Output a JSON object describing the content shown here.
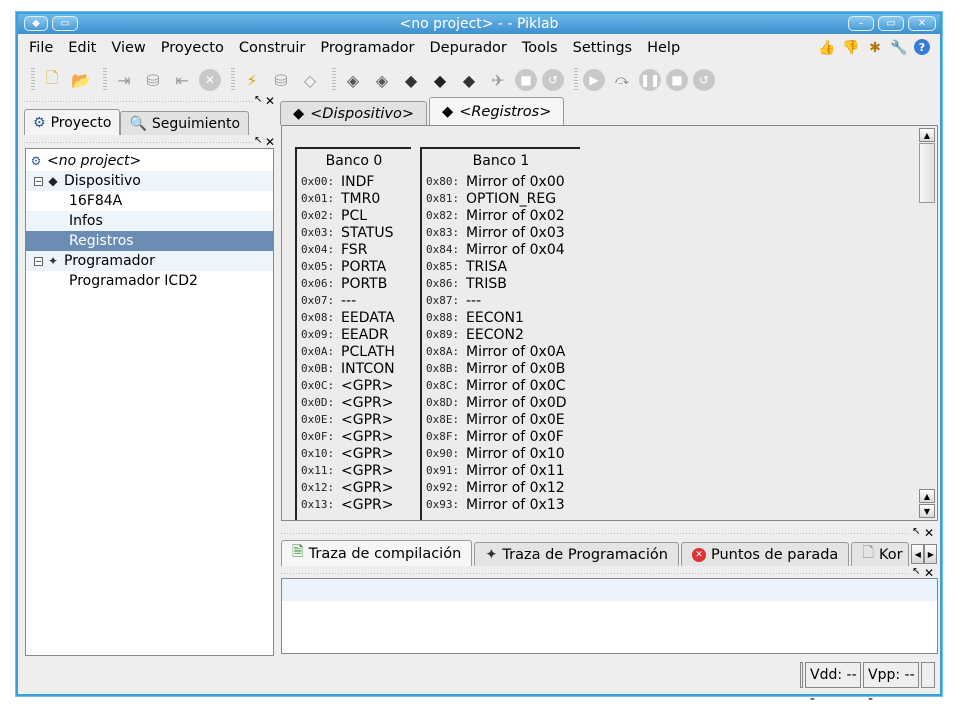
{
  "window": {
    "title": "<no project> -  - Piklab"
  },
  "menubar": {
    "items": [
      {
        "label": "File",
        "name": "menu-file"
      },
      {
        "label": "Edit",
        "name": "menu-edit"
      },
      {
        "label": "View",
        "name": "menu-view"
      },
      {
        "label": "Proyecto",
        "name": "menu-proyecto"
      },
      {
        "label": "Construir",
        "name": "menu-construir"
      },
      {
        "label": "Programador",
        "name": "menu-programador"
      },
      {
        "label": "Depurador",
        "name": "menu-depurador"
      },
      {
        "label": "Tools",
        "name": "menu-tools"
      },
      {
        "label": "Settings",
        "name": "menu-settings"
      },
      {
        "label": "Help",
        "name": "menu-help"
      }
    ],
    "right_icons": [
      "thumbs-up-icon",
      "thumbs-down-icon",
      "bug-icon",
      "wrench-icon",
      "help-icon"
    ]
  },
  "left_panel": {
    "tabs": [
      "Proyecto",
      "Seguimiento"
    ],
    "tree": {
      "root": "<no project>",
      "dispositivo": "Dispositivo",
      "device": "16F84A",
      "infos": "Infos",
      "registros": "Registros",
      "programador": "Programador",
      "programador_icd2": "Programador ICD2"
    }
  },
  "editor": {
    "tabs": [
      "<Dispositivo>",
      "<Registros>"
    ],
    "bank0": {
      "title": "Banco 0",
      "rows": [
        {
          "addr": "0x00:",
          "name": "INDF"
        },
        {
          "addr": "0x01:",
          "name": "TMR0"
        },
        {
          "addr": "0x02:",
          "name": "PCL"
        },
        {
          "addr": "0x03:",
          "name": "STATUS"
        },
        {
          "addr": "0x04:",
          "name": "FSR"
        },
        {
          "addr": "0x05:",
          "name": "PORTA"
        },
        {
          "addr": "0x06:",
          "name": "PORTB"
        },
        {
          "addr": "0x07:",
          "name": "---"
        },
        {
          "addr": "0x08:",
          "name": "EEDATA"
        },
        {
          "addr": "0x09:",
          "name": "EEADR"
        },
        {
          "addr": "0x0A:",
          "name": "PCLATH"
        },
        {
          "addr": "0x0B:",
          "name": "INTCON"
        },
        {
          "addr": "0x0C:",
          "name": "<GPR>"
        },
        {
          "addr": "0x0D:",
          "name": "<GPR>"
        },
        {
          "addr": "0x0E:",
          "name": "<GPR>"
        },
        {
          "addr": "0x0F:",
          "name": "<GPR>"
        },
        {
          "addr": "0x10:",
          "name": "<GPR>"
        },
        {
          "addr": "0x11:",
          "name": "<GPR>"
        },
        {
          "addr": "0x12:",
          "name": "<GPR>"
        },
        {
          "addr": "0x13:",
          "name": "<GPR>"
        }
      ]
    },
    "bank1": {
      "title": "Banco 1",
      "rows": [
        {
          "addr": "0x80:",
          "name": "Mirror of 0x00"
        },
        {
          "addr": "0x81:",
          "name": "OPTION_REG"
        },
        {
          "addr": "0x82:",
          "name": "Mirror of 0x02"
        },
        {
          "addr": "0x83:",
          "name": "Mirror of 0x03"
        },
        {
          "addr": "0x84:",
          "name": "Mirror of 0x04"
        },
        {
          "addr": "0x85:",
          "name": "TRISA"
        },
        {
          "addr": "0x86:",
          "name": "TRISB"
        },
        {
          "addr": "0x87:",
          "name": "---"
        },
        {
          "addr": "0x88:",
          "name": "EECON1"
        },
        {
          "addr": "0x89:",
          "name": "EECON2"
        },
        {
          "addr": "0x8A:",
          "name": "Mirror of 0x0A"
        },
        {
          "addr": "0x8B:",
          "name": "Mirror of 0x0B"
        },
        {
          "addr": "0x8C:",
          "name": "Mirror of 0x0C"
        },
        {
          "addr": "0x8D:",
          "name": "Mirror of 0x0D"
        },
        {
          "addr": "0x8E:",
          "name": "Mirror of 0x0E"
        },
        {
          "addr": "0x8F:",
          "name": "Mirror of 0x0F"
        },
        {
          "addr": "0x90:",
          "name": "Mirror of 0x10"
        },
        {
          "addr": "0x91:",
          "name": "Mirror of 0x11"
        },
        {
          "addr": "0x92:",
          "name": "Mirror of 0x12"
        },
        {
          "addr": "0x93:",
          "name": "Mirror of 0x13"
        }
      ]
    }
  },
  "bottom_panel": {
    "tabs": [
      "Traza de compilación",
      "Traza de Programación",
      "Puntos de parada",
      "Kor"
    ]
  },
  "statusbar": {
    "vdd": "Vdd: ---",
    "vpp": "Vpp: ---"
  },
  "colors": {
    "titlebar": "#3d8fcf",
    "selection": "#6c8db3",
    "window_border": "#3aa0da"
  }
}
